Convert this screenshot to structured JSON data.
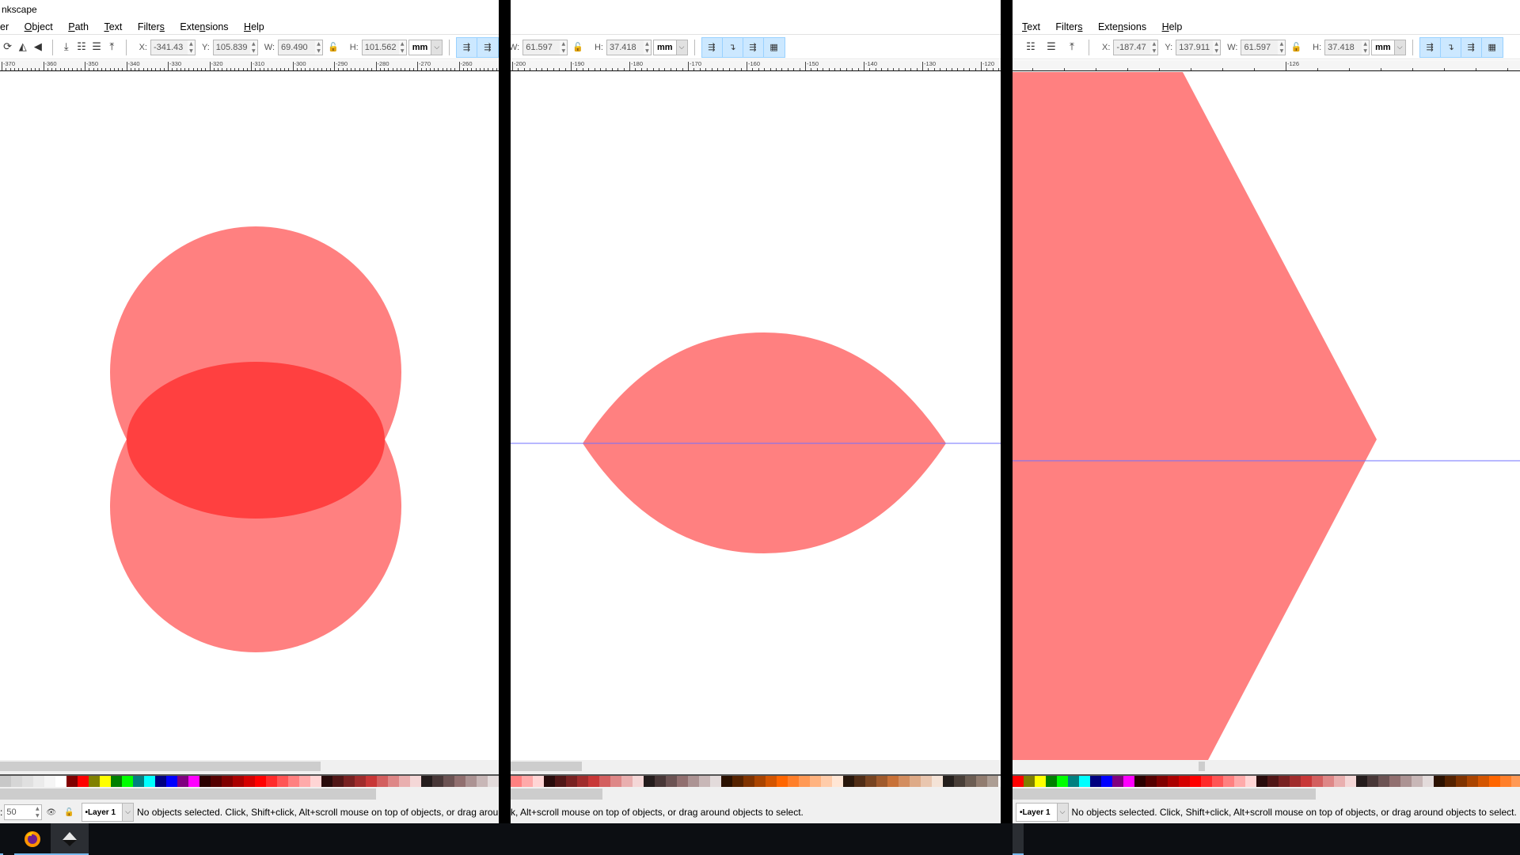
{
  "app": {
    "title_fragment": "nkscape"
  },
  "menus": {
    "left": [
      "er",
      "Object",
      "Path",
      "Text",
      "Filters",
      "Extensions",
      "Help"
    ],
    "right": [
      "Text",
      "Filters",
      "Extensions",
      "Help"
    ]
  },
  "toolbar_left": {
    "x_label": "X:",
    "x_value": "-341.43",
    "y_label": "Y:",
    "y_value": "105.839",
    "w_label": "W:",
    "w_value": "69.490",
    "h_label": "H:",
    "h_value": "101.562",
    "unit": "mm"
  },
  "toolbar_mid": {
    "w_label": "W:",
    "w_value": "61.597",
    "h_label": "H:",
    "h_value": "37.418",
    "unit": "mm"
  },
  "toolbar_right": {
    "x_label": "X:",
    "x_value": "-187.47",
    "y_label": "Y:",
    "y_value": "137.911",
    "w_label": "W:",
    "w_value": "61.597",
    "h_label": "H:",
    "h_value": "37.418",
    "unit": "mm"
  },
  "icons": {
    "object_rotate": "rotate-icon",
    "flip_h": "flip-horizontal-icon",
    "flip_v": "flip-vertical-icon",
    "lower_bottom": "lower-to-bottom-icon",
    "lower": "lower-icon",
    "raise": "raise-icon",
    "raise_top": "raise-to-top-icon",
    "lock": "lock-icon",
    "transform_stroke": "scale-stroke-icon",
    "transform_corners": "scale-corners-icon",
    "transform_gradient": "move-gradients-icon",
    "transform_pattern": "move-patterns-icon"
  },
  "rulers": {
    "left": [
      "-370",
      "-360",
      "-350",
      "-340",
      "-330",
      "-320",
      "-310",
      "-300",
      "-290",
      "-280",
      "-270",
      "-260"
    ],
    "mid": [
      "-200",
      "-190",
      "-180",
      "-170",
      "-160",
      "-150",
      "-140",
      "-130",
      "-120"
    ],
    "right": [
      "-126"
    ]
  },
  "canvas": {
    "fill_color": "#ff8080",
    "overlap_color": "#ff4040",
    "guide_color": "#7070ff"
  },
  "palette": {
    "left": [
      "#c8c8c8",
      "#d6d6d6",
      "#e0e0e0",
      "#ebebeb",
      "#f5f5f5",
      "#ffffff",
      "#800000",
      "#ff0000",
      "#808000",
      "#ffff00",
      "#008000",
      "#00ff00",
      "#008080",
      "#00ffff",
      "#000080",
      "#0000ff",
      "#800080",
      "#ff00ff",
      "#2b0000",
      "#550000",
      "#800000",
      "#aa0000",
      "#d40000",
      "#ff0000",
      "#ff2a2a",
      "#ff5555",
      "#ff8080",
      "#ffaaaa",
      "#ffd5d5",
      "#280b0b",
      "#501616",
      "#782121",
      "#a02c2c",
      "#c83737",
      "#d35f5f",
      "#de8787",
      "#e9afaf",
      "#f4d7d7",
      "#241c1c",
      "#483737",
      "#6c5353",
      "#916f6f",
      "#ac9393",
      "#c8b7b7",
      "#e3dbdb",
      "#2b1100"
    ],
    "mid": [
      "#ff8080",
      "#ffaaaa",
      "#ffd5d5",
      "#280b0b",
      "#501616",
      "#782121",
      "#a02c2c",
      "#c83737",
      "#d35f5f",
      "#de8787",
      "#e9afaf",
      "#f4d7d7",
      "#241c1c",
      "#483737",
      "#6c5353",
      "#916f6f",
      "#ac9393",
      "#c8b7b7",
      "#e3dbdb",
      "#2b1100",
      "#552200",
      "#803300",
      "#aa4400",
      "#d45500",
      "#ff6600",
      "#ff7f2a",
      "#ff9955",
      "#ffb380",
      "#ffccaa",
      "#ffe6d5",
      "#28170b",
      "#502d16",
      "#784421",
      "#a05a2c",
      "#c87137",
      "#d38d5f",
      "#deaa87",
      "#e9c6af",
      "#f4e3d7",
      "#241f1c",
      "#483e37",
      "#6c5d53",
      "#917c6f",
      "#ac9d93"
    ],
    "right": [
      "#ff0000",
      "#808000",
      "#ffff00",
      "#008000",
      "#00ff00",
      "#008080",
      "#00ffff",
      "#000080",
      "#0000ff",
      "#800080",
      "#ff00ff",
      "#2b0000",
      "#550000",
      "#800000",
      "#aa0000",
      "#d40000",
      "#ff0000",
      "#ff2a2a",
      "#ff5555",
      "#ff8080",
      "#ffaaaa",
      "#ffd5d5",
      "#280b0b",
      "#501616",
      "#782121",
      "#a02c2c",
      "#c83737",
      "#d35f5f",
      "#de8787",
      "#e9afaf",
      "#f4d7d7",
      "#241c1c",
      "#483737",
      "#6c5353",
      "#916f6f",
      "#ac9393",
      "#c8b7b7",
      "#e3dbdb",
      "#2b1100",
      "#552200",
      "#803300",
      "#aa4400",
      "#d45500",
      "#ff6600",
      "#ff7f2a",
      "#ff9955"
    ]
  },
  "status": {
    "zoom_label": ":",
    "zoom_value": "50",
    "layer": "•Layer 1",
    "message": "No objects selected. Click, Shift+click, Alt+scroll mouse on top of objects, or drag around objects to select.",
    "message_mid": "k, Alt+scroll mouse on top of objects, or drag around objects to select."
  },
  "taskbar": {
    "apps": [
      "firefox",
      "inkscape"
    ]
  }
}
